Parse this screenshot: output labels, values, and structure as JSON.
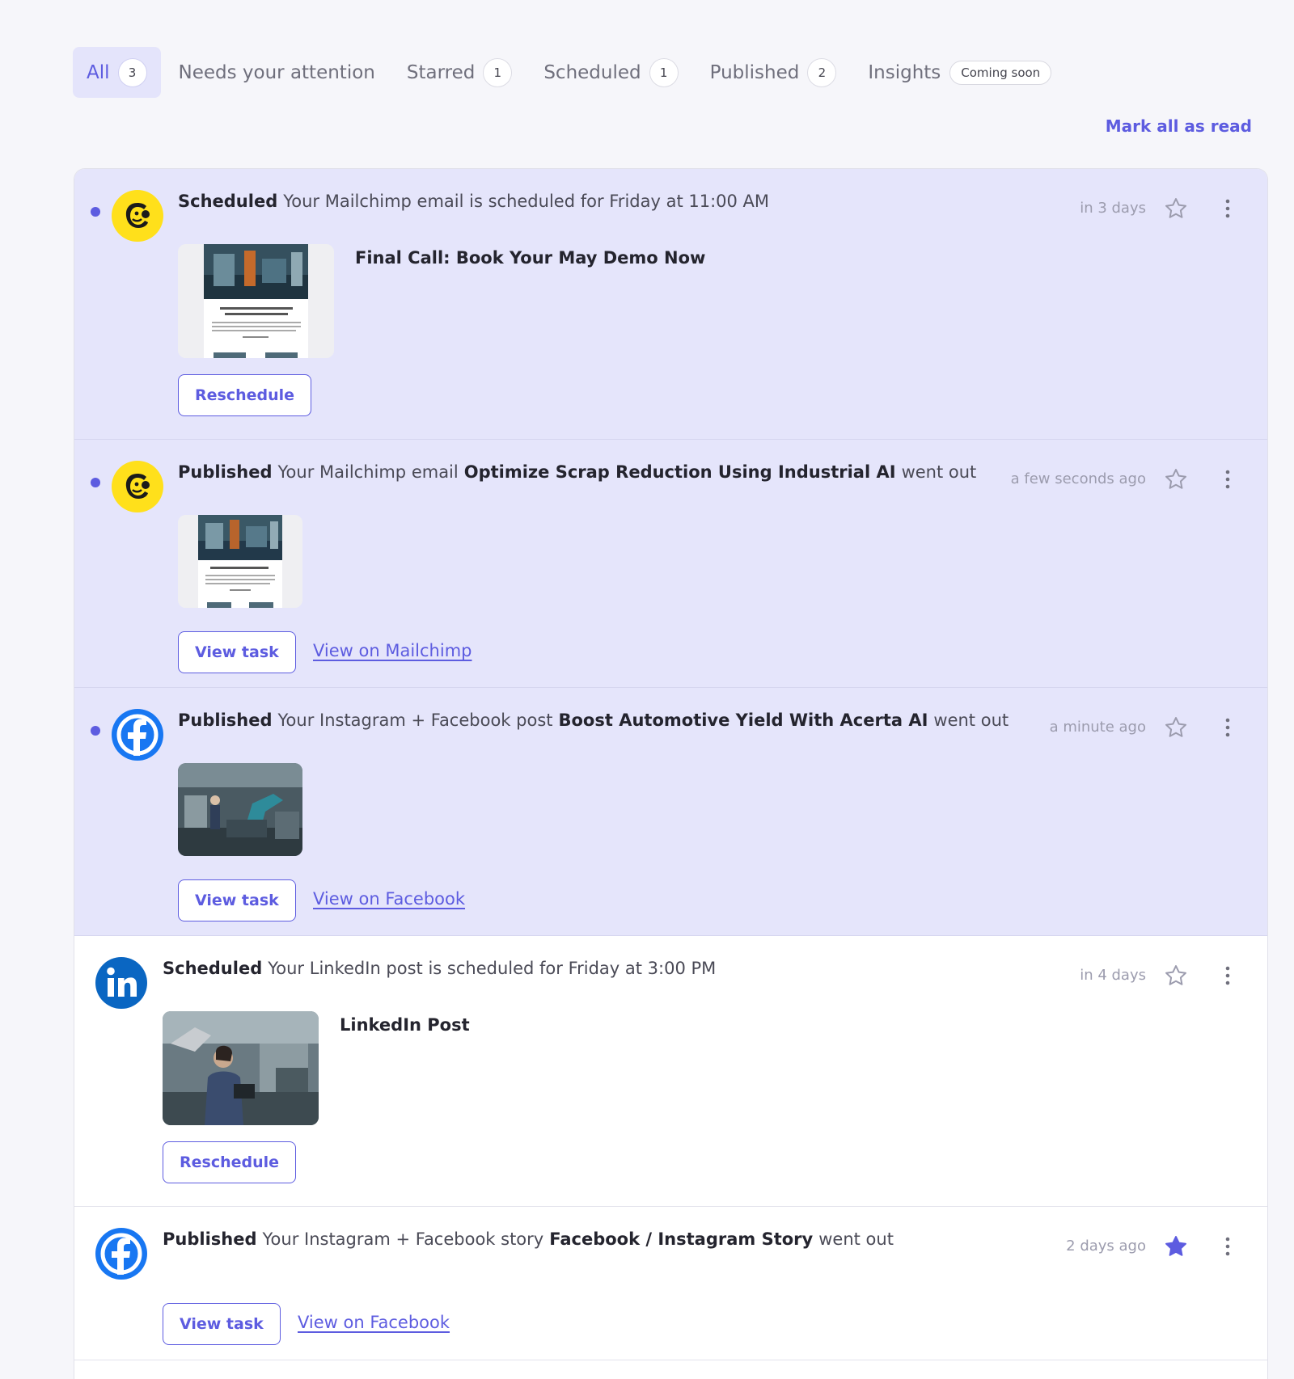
{
  "tabs": [
    {
      "label": "All",
      "count": "3"
    },
    {
      "label": "Needs your attention"
    },
    {
      "label": "Starred",
      "count": "1"
    },
    {
      "label": "Scheduled",
      "count": "1"
    },
    {
      "label": "Published",
      "count": "2"
    },
    {
      "label": "Insights",
      "badge": "Coming soon"
    }
  ],
  "active_tab": "All",
  "mark_all_read": "Mark all as read",
  "colors": {
    "accent": "#5d5ce0",
    "unread_bg": "#e5e5fb",
    "mailchimp_yellow": "#ffe01b",
    "facebook_blue": "#1877f2",
    "linkedin_blue": "#0a66c2"
  },
  "notifications": [
    {
      "unread": true,
      "source_icon": "mailchimp-icon",
      "status": "Scheduled",
      "text_before": "Your Mailchimp email is scheduled for Friday at 11:00 AM",
      "time": "in 3 days",
      "starred": false,
      "content_title": "Final Call: Book Your May Demo Now",
      "button": "Reschedule"
    },
    {
      "unread": true,
      "source_icon": "mailchimp-icon",
      "status": "Published",
      "text_before": "Your Mailchimp email",
      "bold": "Optimize Scrap Reduction Using Industrial AI",
      "text_after": "went out",
      "time": "a few seconds ago",
      "starred": false,
      "button": "View task",
      "link": "View on Mailchimp"
    },
    {
      "unread": true,
      "source_icon": "facebook-icon",
      "status": "Published",
      "text_before": "Your Instagram + Facebook post",
      "bold": "Boost Automotive Yield With Acerta AI",
      "text_after": "went out",
      "time": "a minute ago",
      "starred": false,
      "button": "View task",
      "link": "View on Facebook"
    },
    {
      "unread": false,
      "source_icon": "linkedin-icon",
      "status": "Scheduled",
      "text_before": "Your LinkedIn post is scheduled for Friday at 3:00 PM",
      "time": "in 4 days",
      "starred": false,
      "content_title": "LinkedIn Post",
      "button": "Reschedule"
    },
    {
      "unread": false,
      "source_icon": "facebook-icon",
      "status": "Published",
      "text_before": "Your Instagram + Facebook story",
      "bold": "Facebook / Instagram Story",
      "text_after": "went out",
      "time": "2 days ago",
      "starred": true,
      "button": "View task",
      "link": "View on Facebook"
    }
  ]
}
